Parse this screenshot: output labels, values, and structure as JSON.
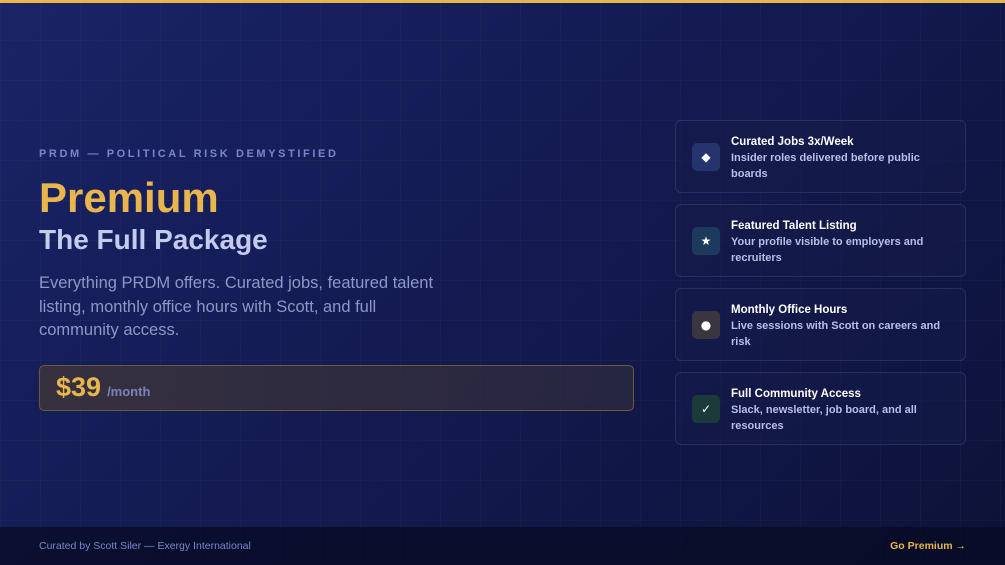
{
  "brand": {
    "eyebrow": "PRDM — POLITICAL RISK DEMYSTIFIED",
    "accent_color": "#e8b64c"
  },
  "hero": {
    "title": "Premium",
    "subtitle": "The Full Package",
    "description": "Everything PRDM offers. Curated jobs, featured talent listing, monthly office hours with Scott, and full community access."
  },
  "pricing": {
    "amount": "$39",
    "period": "/month"
  },
  "features": [
    {
      "icon": "diamond-icon",
      "glyph": "◆",
      "icon_bg": "#25346e",
      "title": "Curated Jobs 3x/Week",
      "description": "Insider roles delivered before public boards"
    },
    {
      "icon": "star-icon",
      "glyph": "★",
      "icon_bg": "#1d3a5c",
      "title": "Featured Talent Listing",
      "description": "Your profile visible to employers and recruiters"
    },
    {
      "icon": "dot-icon",
      "glyph": "●",
      "icon_bg": "#3a3640",
      "title": "Monthly Office Hours",
      "description": "Live sessions with Scott on careers and risk"
    },
    {
      "icon": "check-icon",
      "glyph": "✓",
      "icon_bg": "#1b3a3a",
      "title": "Full Community Access",
      "description": "Slack, newsletter, job board, and all resources"
    }
  ],
  "footer": {
    "credit": "Curated by Scott Siler — Exergy International",
    "cta": "Go Premium →"
  }
}
